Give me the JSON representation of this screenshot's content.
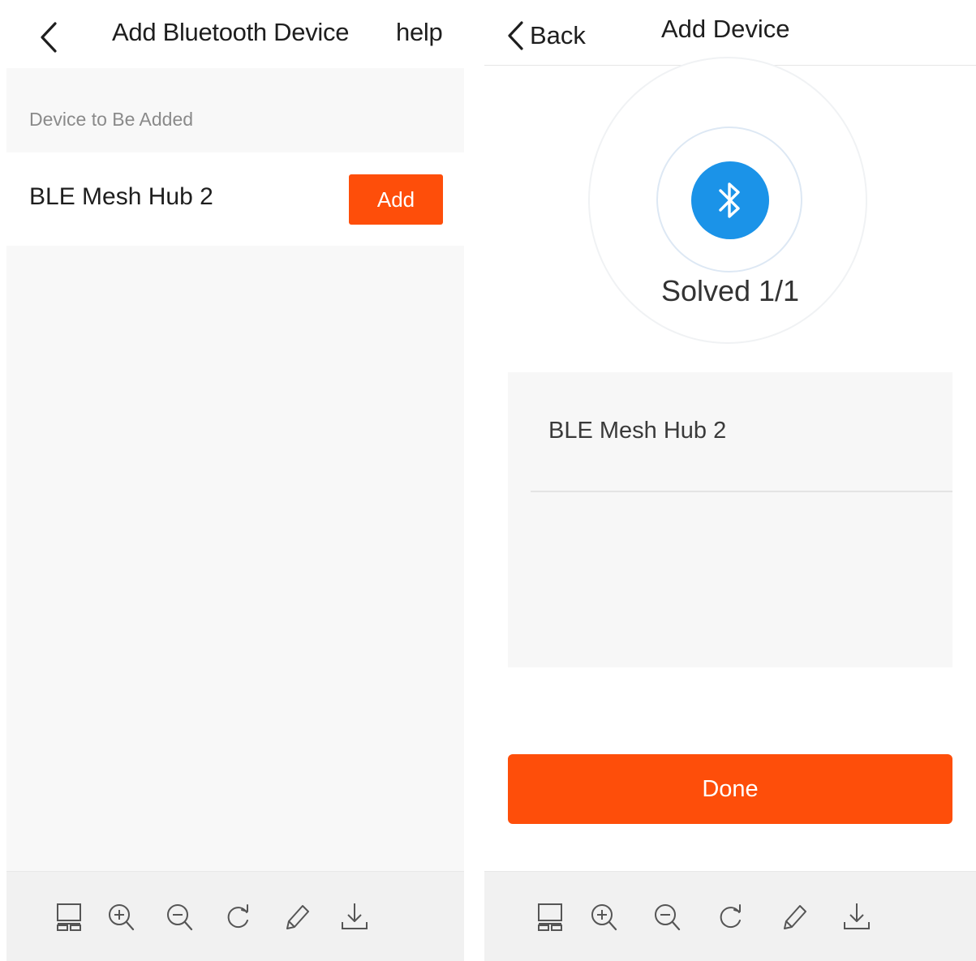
{
  "left_screen": {
    "nav": {
      "title": "Add Bluetooth Device",
      "help_label": "help"
    },
    "section_label": "Device to Be Added",
    "device": {
      "name": "BLE Mesh Hub 2",
      "add_label": "Add"
    }
  },
  "right_screen": {
    "nav": {
      "back_label": "Back",
      "title": "Add Device"
    },
    "status": {
      "text": "Solved 1/1"
    },
    "device": {
      "name": "BLE Mesh Hub 2"
    },
    "done_label": "Done"
  },
  "toolbar": {
    "icons": [
      "layout-icon",
      "zoom-in-icon",
      "zoom-out-icon",
      "rotate-icon",
      "edit-icon",
      "download-icon"
    ]
  },
  "colors": {
    "accent": "#fe4e0a",
    "bluetooth": "#1b93e8",
    "text_primary": "#1e1e1e",
    "text_secondary": "#8a8a8a",
    "panel_bg": "#f8f8f8",
    "toolbar_bg": "#f1f1f1"
  }
}
